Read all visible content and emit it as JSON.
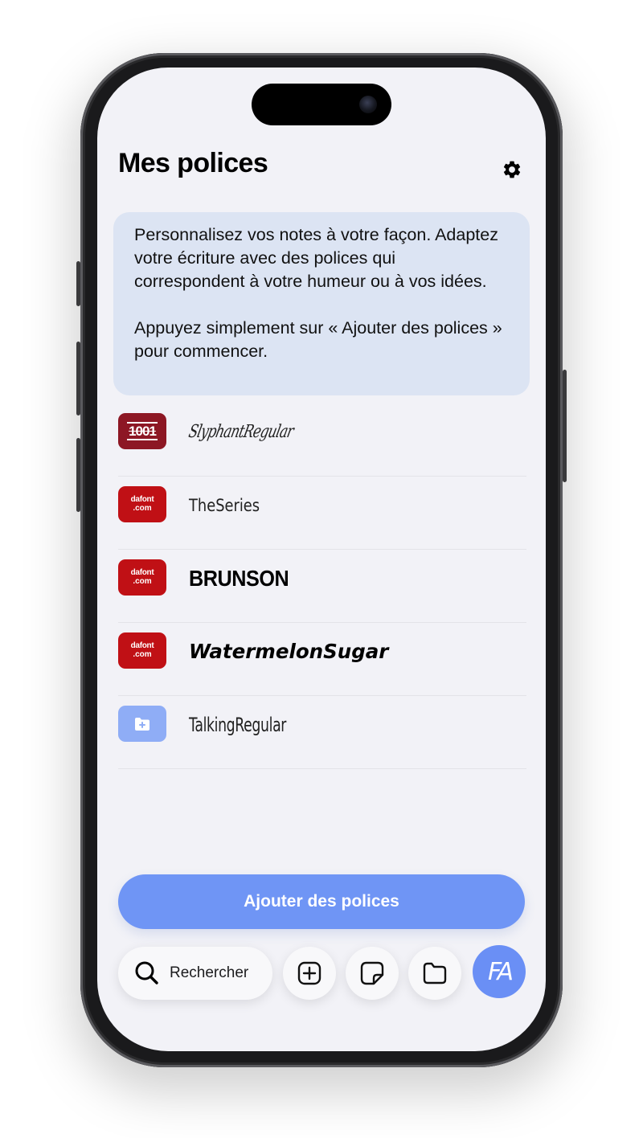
{
  "header": {
    "title": "Mes polices",
    "settings_icon": "gear-icon"
  },
  "info_card": {
    "paragraph_1": "Personnalisez vos notes à votre façon. Adaptez votre écriture avec des polices qui correspondent à votre humeur ou à vos idées.",
    "paragraph_2": "Appuyez simplement sur « Ajouter des polices » pour commencer."
  },
  "fonts": [
    {
      "name": "SlyphantRegular",
      "source": "1001",
      "source_label": "1001"
    },
    {
      "name": "TheSeries",
      "source": "dafont",
      "source_label_1": "dafont",
      "source_label_2": ".com"
    },
    {
      "name": "BRUNSON",
      "source": "dafont",
      "source_label_1": "dafont",
      "source_label_2": ".com"
    },
    {
      "name": "WatermelonSugar",
      "source": "dafont",
      "source_label_1": "dafont",
      "source_label_2": ".com"
    },
    {
      "name": "TalkingRegular",
      "source": "folder",
      "source_icon": "folder-plus-icon"
    }
  ],
  "actions": {
    "add_fonts_label": "Ajouter des polices"
  },
  "toolbar": {
    "search_label": "Rechercher",
    "search_icon": "search-icon",
    "new_note_icon": "plus-square-icon",
    "sticky_note_icon": "sticky-note-icon",
    "folder_icon": "folder-icon",
    "fonts_icon_text": "FA"
  },
  "colors": {
    "accent": "#6f95f5",
    "info_card_bg": "#dce4f3",
    "dafont_red": "#c01015",
    "brand_1001": "#8d1724",
    "folder_blue": "#8fadf6"
  }
}
